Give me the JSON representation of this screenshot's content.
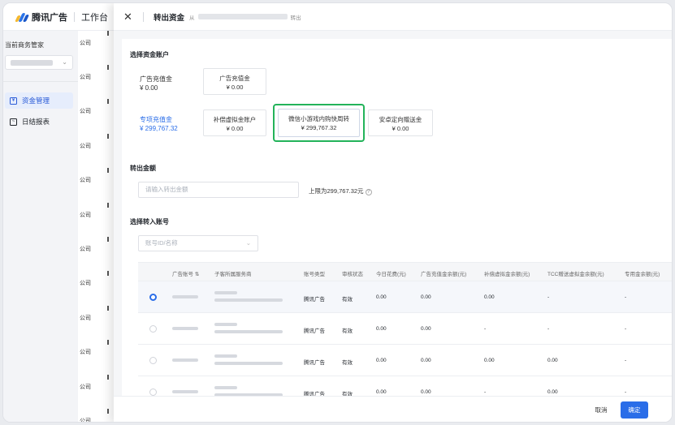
{
  "app": {
    "brand": "腾讯广告",
    "workbench": "工作台"
  },
  "sidebar": {
    "title": "当前商务管家",
    "items": [
      {
        "label": "资金管理",
        "icon": "wallet-icon",
        "active": true
      },
      {
        "label": "日结报表",
        "icon": "chart-icon",
        "active": false
      }
    ]
  },
  "bg_table": {
    "company_suffix": "公司"
  },
  "drawer": {
    "title": "转出资金",
    "from": "从",
    "out": "转出",
    "section_account": "选择资金账户",
    "ad_recharge_label": "广告充值金",
    "ad_recharge_amount": "¥ 0.00",
    "ad_recharge_box_label": "广告充值金",
    "ad_recharge_box_amount": "¥ 0.00",
    "special_label": "专项充值金",
    "special_amount": "¥ 299,767.32",
    "boxes": [
      {
        "label": "补偿虚拟金账户",
        "amount": "¥ 0.00"
      },
      {
        "label": "微信小游戏内购快周转",
        "amount": "¥ 299,767.32"
      },
      {
        "label": "安卓定向赠送金",
        "amount": "¥ 0.00"
      }
    ],
    "section_amount": "转出金额",
    "amount_placeholder": "请输入转出金额",
    "limit_text": "上限为299,767.32元",
    "section_target": "选择转入账号",
    "target_placeholder": "账号ID/名称",
    "table": {
      "headers": [
        "广告账号",
        "子客所属服务商",
        "账号类型",
        "审核状态",
        "今日花费(元)",
        "广告充值金余额(元)",
        "补偿虚拟金余额(元)",
        "TCC赠送虚拟金余额(元)",
        "专用金余额(元)"
      ],
      "rows": [
        {
          "type": "腾讯广告",
          "status": "有效",
          "spend": "0.00",
          "recharge": "0.00",
          "comp": "0.00",
          "tcc": "-",
          "special": "-"
        },
        {
          "type": "腾讯广告",
          "status": "有效",
          "spend": "0.00",
          "recharge": "0.00",
          "comp": "-",
          "tcc": "-",
          "special": "-"
        },
        {
          "type": "腾讯广告",
          "status": "有效",
          "spend": "0.00",
          "recharge": "0.00",
          "comp": "0.00",
          "tcc": "0.00",
          "special": "-"
        },
        {
          "type": "腾讯广告",
          "status": "有效",
          "spend": "0.00",
          "recharge": "0.00",
          "comp": "-",
          "tcc": "0.00",
          "special": "-"
        }
      ]
    },
    "cancel": "取消",
    "confirm": "确定"
  }
}
